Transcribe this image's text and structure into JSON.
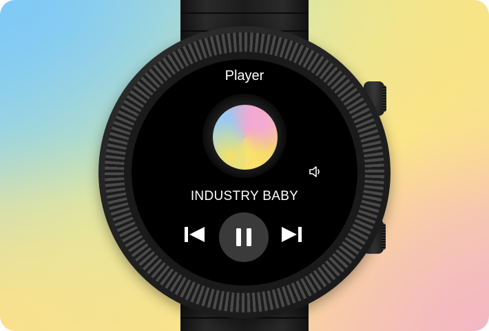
{
  "app": {
    "title": "Player"
  },
  "track": {
    "name": "INDUSTRY BABY"
  },
  "controls": {
    "previous_icon": "skip-previous-icon",
    "play_pause_icon": "pause-icon",
    "next_icon": "skip-next-icon",
    "volume_icon": "volume-icon"
  },
  "colors": {
    "screen": "#000000",
    "text": "#ffffff",
    "play_button_bg": "#3a3a3a"
  }
}
